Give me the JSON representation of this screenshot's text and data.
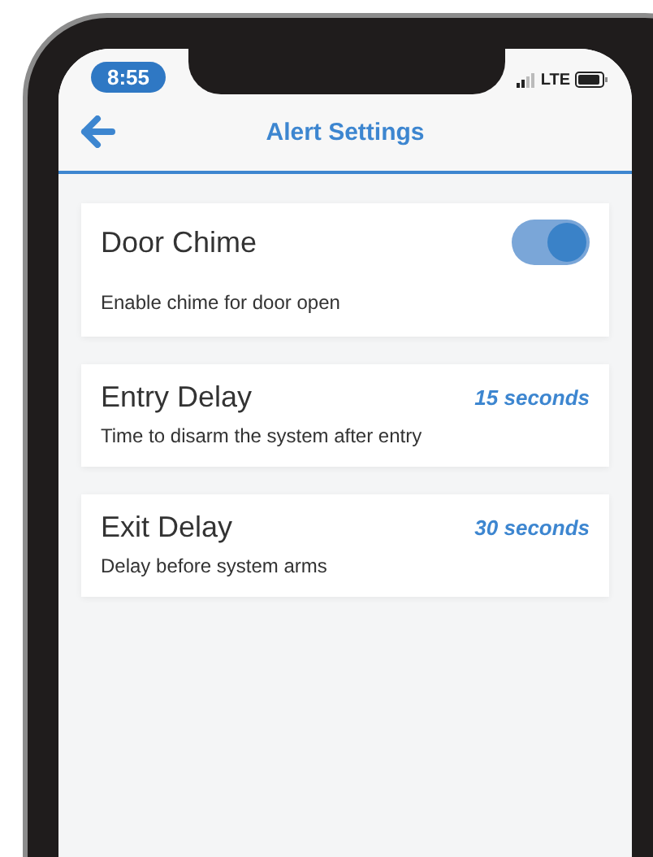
{
  "status_bar": {
    "time": "8:55",
    "network": "LTE"
  },
  "header": {
    "title": "Alert Settings"
  },
  "settings": [
    {
      "kind": "toggle",
      "title": "Door Chime",
      "description": "Enable chime for door open",
      "on": true
    },
    {
      "kind": "value",
      "title": "Entry Delay",
      "value": "15 seconds",
      "description": "Time to disarm the system after entry"
    },
    {
      "kind": "value",
      "title": "Exit Delay",
      "value": "30 seconds",
      "description": "Delay before system arms"
    }
  ]
}
